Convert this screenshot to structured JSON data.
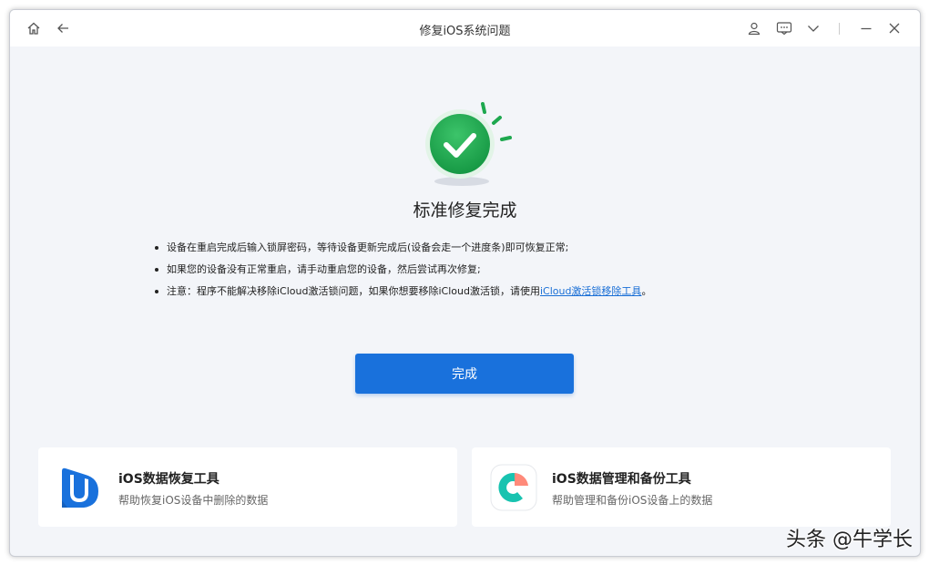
{
  "window": {
    "title": "修复iOS系统问题"
  },
  "titlebar_icons": {
    "left": [
      "home-icon",
      "back-arrow-icon"
    ],
    "right": [
      "user-icon",
      "feedback-icon",
      "chevron-down-icon",
      "minimize-icon",
      "close-icon"
    ]
  },
  "status": {
    "icon": "check-circle-icon",
    "title": "标准修复完成"
  },
  "notes": [
    {
      "text": "设备在重启完成后输入锁屏密码，等待设备更新完成后(设备会走一个进度条)即可恢复正常;"
    },
    {
      "text": "如果您的设备没有正常重启，请手动重启您的设备，然后尝试再次修复;"
    },
    {
      "text_before": "注意：程序不能解决移除iCloud激活锁问题，如果你想要移除iCloud激活锁，请使用",
      "link": "iCloud激活锁移除工具",
      "text_after": "。"
    }
  ],
  "done_button": "完成",
  "products": [
    {
      "icon": "data-recovery-app-icon",
      "title": "iOS数据恢复工具",
      "subtitle": "帮助恢复iOS设备中删除的数据"
    },
    {
      "icon": "data-manager-app-icon",
      "title": "iOS数据管理和备份工具",
      "subtitle": "帮助管理和备份iOS设备上的数据"
    }
  ],
  "watermark": "头条 @牛学长",
  "colors": {
    "accent": "#1971dc",
    "success": "#1ea84f",
    "background": "#f3f5f9"
  }
}
